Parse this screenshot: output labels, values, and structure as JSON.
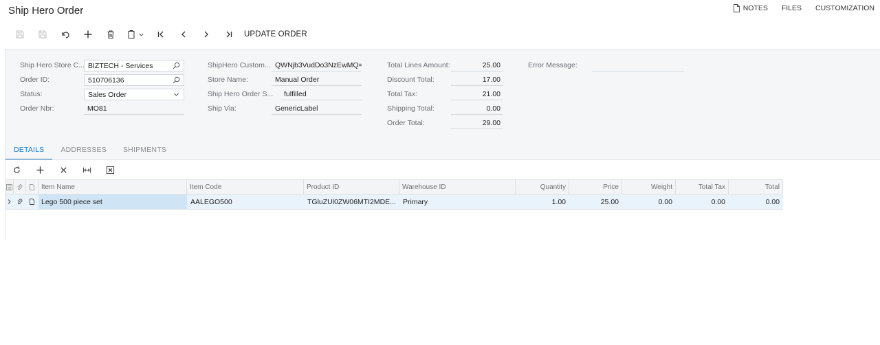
{
  "title": "Ship Hero Order",
  "top_links": {
    "notes": "NOTES",
    "files": "FILES",
    "customization": "CUSTOMIZATION"
  },
  "toolbar": {
    "update_order": "UPDATE ORDER"
  },
  "form": {
    "store_label": "Ship Hero Store C...",
    "store_value": "BIZTECH - Services",
    "order_id_label": "Order ID:",
    "order_id_value": "510706136",
    "status_label": "Status:",
    "status_value": "Sales Order",
    "order_nbr_label": "Order Nbr:",
    "order_nbr_value": "MO81",
    "customer_label": "ShipHero Custom...",
    "customer_value": "QWNjb3VudDo3NzEwMQ=",
    "store_name_label": "Store Name:",
    "store_name_value": "Manual Order",
    "order_status_label": "Ship Hero Order S...",
    "order_status_value": "fulfilled",
    "ship_via_label": "Ship Via:",
    "ship_via_value": "GenericLabel",
    "total_lines_label": "Total Lines Amount:",
    "total_lines_value": "25.00",
    "discount_label": "Discount Total:",
    "discount_value": "17.00",
    "tax_label": "Total Tax:",
    "tax_value": "21.00",
    "shipping_label": "Shipping Total:",
    "shipping_value": "0.00",
    "order_total_label": "Order Total:",
    "order_total_value": "29.00",
    "error_label": "Error Message:",
    "error_value": ""
  },
  "tabs": [
    "DETAILS",
    "ADDRESSES",
    "SHIPMENTS"
  ],
  "grid": {
    "columns": [
      "Item Name",
      "Item Code",
      "Product ID",
      "Warehouse ID",
      "Quantity",
      "Price",
      "Weight",
      "Total Tax",
      "Total"
    ],
    "rows": [
      [
        "Lego 500 piece set",
        "AALEGO500",
        "TGluZUl0ZW06MTI2MDE...",
        "Primary",
        "1.00",
        "25.00",
        "0.00",
        "0.00",
        "0.00"
      ]
    ]
  },
  "colors": {
    "accent": "#1c79c2",
    "panel": "#f4f6f8",
    "row_selected": "#e9f3fb"
  }
}
